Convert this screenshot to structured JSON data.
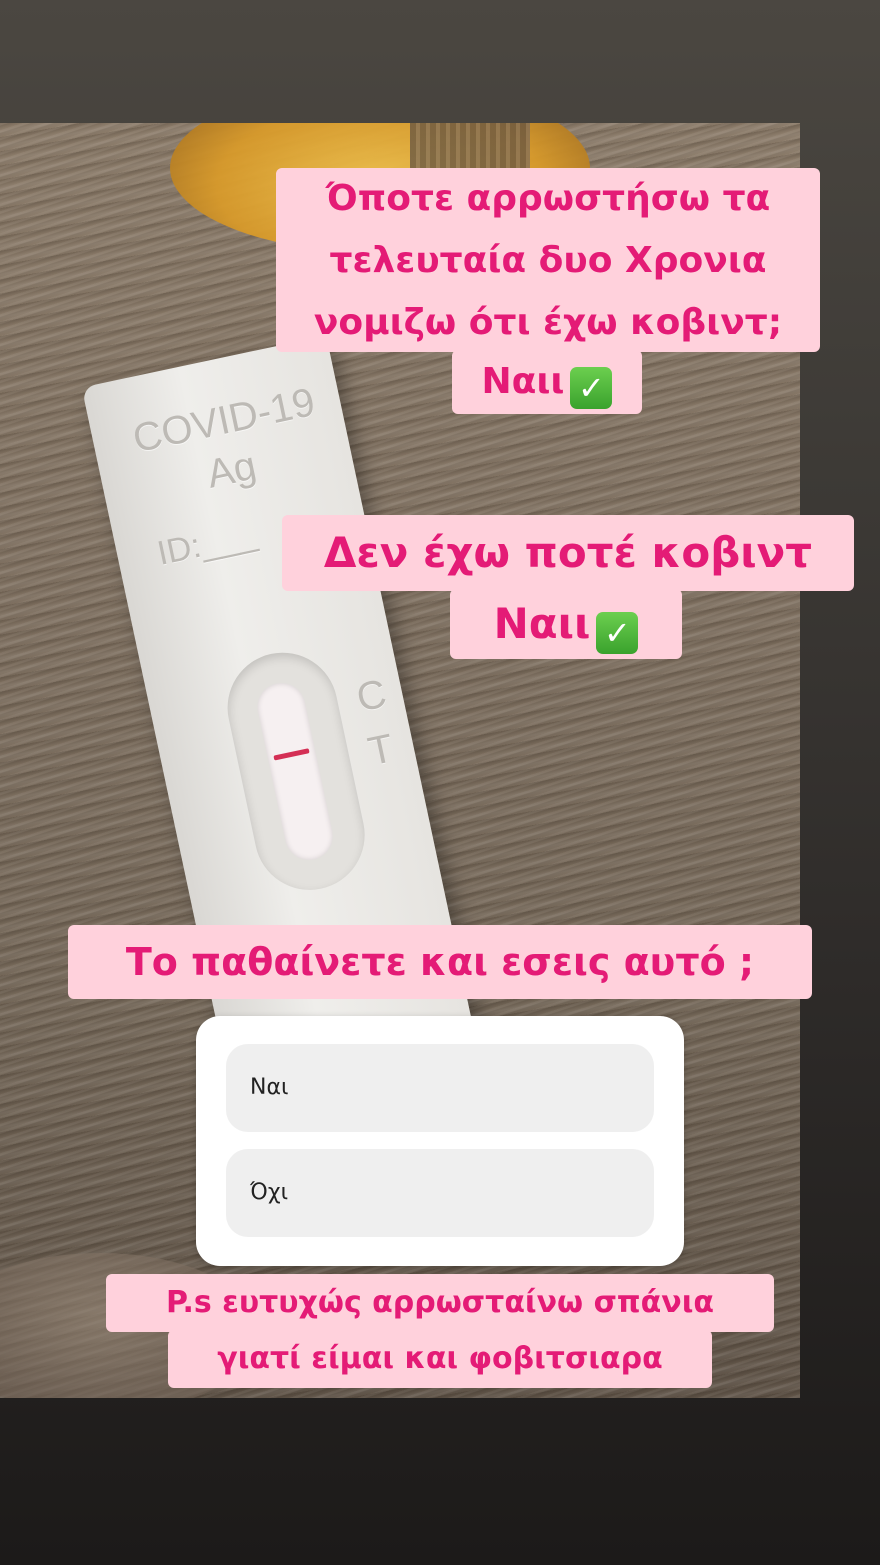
{
  "story": {
    "photo": {
      "test_label_line1": "COVID-19",
      "test_label_line2": "Ag",
      "test_id_label": "ID:___",
      "marker_c": "C",
      "marker_t": "T"
    },
    "sticker1": {
      "lines": [
        "Όποτε αρρωστήσω τα",
        "τελευταία δυο Χρονια",
        "νομιζω ότι έχω κοβιντ;",
        "Ναιι"
      ],
      "check_icon": "check-mark-button-icon"
    },
    "sticker2": {
      "lines": [
        "Δεν έχω ποτέ κοβιντ",
        "Ναιι"
      ],
      "check_icon": "check-mark-button-icon"
    },
    "question": "Το παθαίνετε και εσεις αυτό ;",
    "poll": {
      "options": [
        "Ναι",
        "Όχι"
      ]
    },
    "footer": {
      "lines": [
        "P.s ευτυχώς αρρωσταίνω σπάνια",
        "γιατί είμαι και φοβιτσιαρα"
      ]
    },
    "colors": {
      "sticker_bg": "#ffd1dc",
      "sticker_text": "#e41b76",
      "check_green": "#3aa22d"
    }
  }
}
